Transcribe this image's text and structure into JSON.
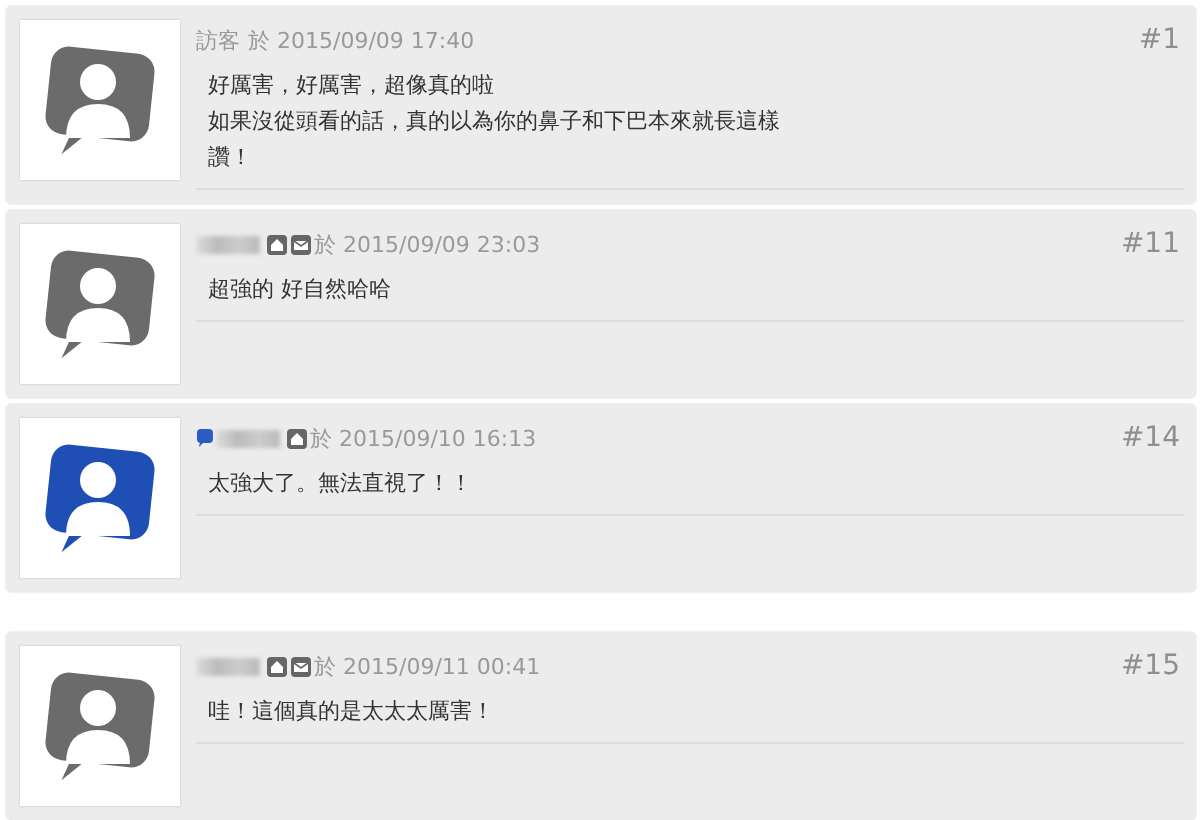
{
  "comments": [
    {
      "color": "#6b6b6b",
      "meta": [
        {
          "kind": "name",
          "text": "訪客"
        }
      ],
      "timestamp": "於 2015/09/09 17:40",
      "number": "#1",
      "lines": [
        "好厲害，好厲害，超像真的啦",
        "如果沒從頭看的話，真的以為你的鼻子和下巴本來就長這樣",
        "讚！"
      ]
    },
    {
      "color": "#6b6b6b",
      "meta": [
        {
          "kind": "redacted"
        },
        {
          "kind": "home"
        },
        {
          "kind": "mail"
        }
      ],
      "timestamp": "於 2015/09/09 23:03",
      "number": "#11",
      "lines": [
        "超強的 好自然哈哈"
      ]
    },
    {
      "color": "#1f4fb5",
      "meta": [
        {
          "kind": "bubble"
        },
        {
          "kind": "redacted"
        },
        {
          "kind": "home"
        }
      ],
      "timestamp": "於 2015/09/10 16:13",
      "number": "#14",
      "lines": [
        "太強大了。無法直視了！！"
      ]
    },
    {
      "color": "#6b6b6b",
      "meta": [
        {
          "kind": "redacted"
        },
        {
          "kind": "home"
        },
        {
          "kind": "mail"
        }
      ],
      "timestamp": "於 2015/09/11 00:41",
      "number": "#15",
      "lines": [
        "哇！這個真的是太太太厲害！"
      ]
    }
  ]
}
